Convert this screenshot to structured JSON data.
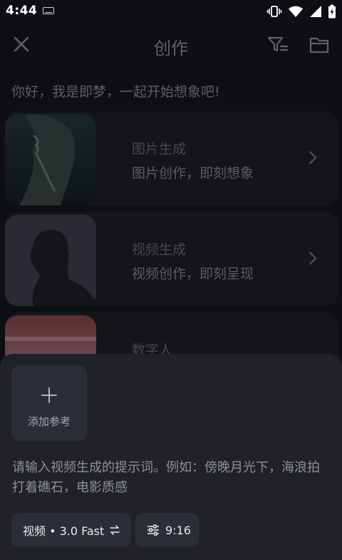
{
  "status_bar": {
    "time": "4:44"
  },
  "header": {
    "title": "创作"
  },
  "greeting": "你好，我是即梦，一起开始想象吧!",
  "cards": [
    {
      "title": "图片生成",
      "subtitle": "图片创作，即刻想象"
    },
    {
      "title": "视频生成",
      "subtitle": "视频创作，即刻呈现"
    },
    {
      "title": "数字人",
      "subtitle": ""
    }
  ],
  "sheet": {
    "add_reference_label": "添加参考",
    "prompt_placeholder": "请输入视频生成的提示词。例如：傍晚月光下，海浪拍打着礁石，电影质感",
    "model_chip_label": "视频 • 3.0 Fast",
    "ratio_chip_label": "9:16"
  },
  "colors": {
    "background": "#0e0f12",
    "sheet": "#202228",
    "chip": "#2c2e35"
  }
}
